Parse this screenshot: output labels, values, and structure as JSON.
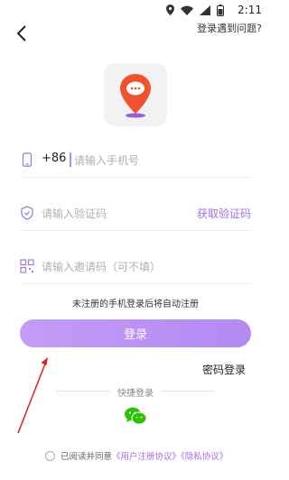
{
  "status_bar": {
    "time": "2:11"
  },
  "header": {
    "help_link": "登录遇到问题?"
  },
  "form": {
    "phone_prefix": "+86",
    "phone_placeholder": "请输入手机号",
    "code_placeholder": "请输入验证码",
    "get_code_label": "获取验证码",
    "invite_placeholder": "请输入邀请码（可不填）",
    "notice": "未注册的手机登录后将自动注册",
    "login_button": "登录",
    "password_login": "密码登录"
  },
  "quick_login": {
    "label": "快捷登录"
  },
  "agreement": {
    "prefix": "已阅读并同意",
    "user_agreement": "《用户注册协议》",
    "privacy_policy": "《隐私协议》"
  },
  "colors": {
    "accent": "#a56ef0",
    "button": "#b892f5",
    "logo_orange": "#f0522d",
    "wechat": "#2dc100"
  }
}
